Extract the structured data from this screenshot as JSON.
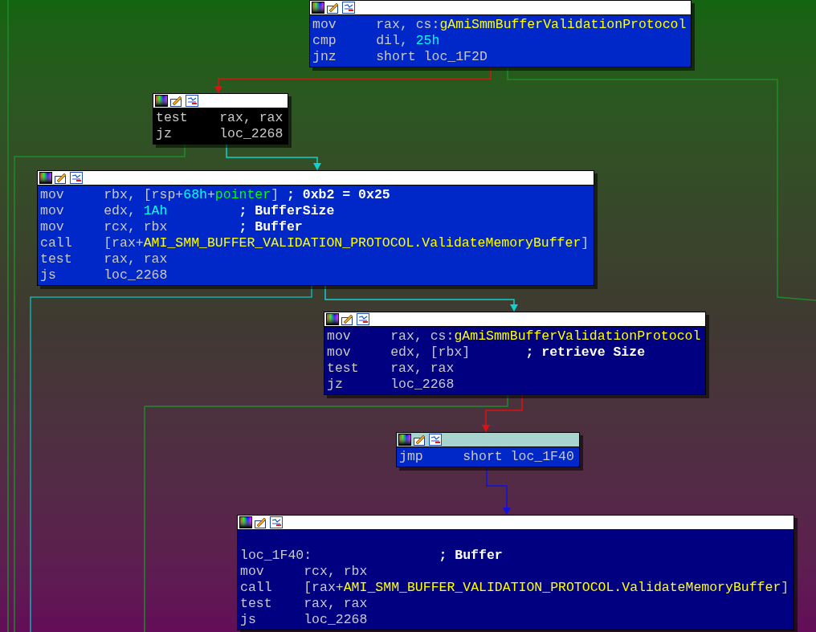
{
  "nodes": [
    {
      "selected": false,
      "color": "#0028c8",
      "lines": [
        {
          "mnemonic": "mov",
          "operands": [
            {
              "text": "rax, cs:",
              "kind": "text"
            },
            {
              "text": "gAmiSmmBufferValidationProtocol",
              "kind": "name"
            }
          ]
        },
        {
          "mnemonic": "cmp",
          "operands": [
            {
              "text": "dil, ",
              "kind": "text"
            },
            {
              "text": "25h",
              "kind": "number"
            }
          ]
        },
        {
          "mnemonic": "jnz",
          "operands": [
            {
              "text": "short loc_1F2D",
              "kind": "text"
            }
          ]
        }
      ]
    },
    {
      "selected": false,
      "color": "#000000",
      "lines": [
        {
          "mnemonic": "test",
          "operands": [
            {
              "text": "rax, rax",
              "kind": "text"
            }
          ]
        },
        {
          "mnemonic": "jz",
          "operands": [
            {
              "text": "loc_2268",
              "kind": "text"
            }
          ]
        }
      ]
    },
    {
      "selected": false,
      "color": "#0028c8",
      "lines": [
        {
          "mnemonic": "mov",
          "operands": [
            {
              "text": "rbx, [rsp+",
              "kind": "text"
            },
            {
              "text": "68h",
              "kind": "number"
            },
            {
              "text": "+",
              "kind": "text"
            },
            {
              "text": "pointer",
              "kind": "var"
            },
            {
              "text": "]",
              "kind": "text"
            }
          ],
          "comment": "; 0xb2 = 0x25"
        },
        {
          "mnemonic": "mov",
          "operands": [
            {
              "text": "edx, ",
              "kind": "text"
            },
            {
              "text": "1Ah",
              "kind": "number"
            }
          ],
          "comment": "; BufferSize"
        },
        {
          "mnemonic": "mov",
          "operands": [
            {
              "text": "rcx, rbx",
              "kind": "text"
            }
          ],
          "comment": "; Buffer"
        },
        {
          "mnemonic": "call",
          "operands": [
            {
              "text": "[rax+",
              "kind": "text"
            },
            {
              "text": "AMI_SMM_BUFFER_VALIDATION_PROTOCOL.ValidateMemoryBuffer",
              "kind": "name"
            },
            {
              "text": "]",
              "kind": "text"
            }
          ]
        },
        {
          "mnemonic": "test",
          "operands": [
            {
              "text": "rax, rax",
              "kind": "text"
            }
          ]
        },
        {
          "mnemonic": "js",
          "operands": [
            {
              "text": "loc_2268",
              "kind": "text"
            }
          ]
        }
      ]
    },
    {
      "selected": false,
      "color": "#000080",
      "lines": [
        {
          "mnemonic": "mov",
          "operands": [
            {
              "text": "rax, cs:",
              "kind": "text"
            },
            {
              "text": "gAmiSmmBufferValidationProtocol",
              "kind": "name"
            }
          ]
        },
        {
          "mnemonic": "mov",
          "operands": [
            {
              "text": "edx, [rbx]",
              "kind": "text"
            }
          ],
          "comment": "; retrieve Size"
        },
        {
          "mnemonic": "test",
          "operands": [
            {
              "text": "rax, rax",
              "kind": "text"
            }
          ]
        },
        {
          "mnemonic": "jz",
          "operands": [
            {
              "text": "loc_2268",
              "kind": "text"
            }
          ]
        }
      ]
    },
    {
      "selected": true,
      "color": "#0028c8",
      "lines": [
        {
          "mnemonic": "jmp",
          "operands": [
            {
              "text": "short loc_1F40",
              "kind": "text"
            }
          ]
        }
      ]
    },
    {
      "selected": false,
      "color": "#000080",
      "lines": [
        {
          "label": "loc_1F40:",
          "comment": "; Buffer"
        },
        {
          "mnemonic": "mov",
          "operands": [
            {
              "text": "rcx, rbx",
              "kind": "text"
            }
          ]
        },
        {
          "mnemonic": "call",
          "operands": [
            {
              "text": "[rax+",
              "kind": "text"
            },
            {
              "text": "AMI_SMM_BUFFER_VALIDATION_PROTOCOL.ValidateMemoryBuffer",
              "kind": "name"
            },
            {
              "text": "]",
              "kind": "text"
            }
          ]
        },
        {
          "mnemonic": "test",
          "operands": [
            {
              "text": "rax, rax",
              "kind": "text"
            }
          ]
        },
        {
          "mnemonic": "js",
          "operands": [
            {
              "text": "loc_2268",
              "kind": "text"
            }
          ]
        }
      ]
    }
  ]
}
